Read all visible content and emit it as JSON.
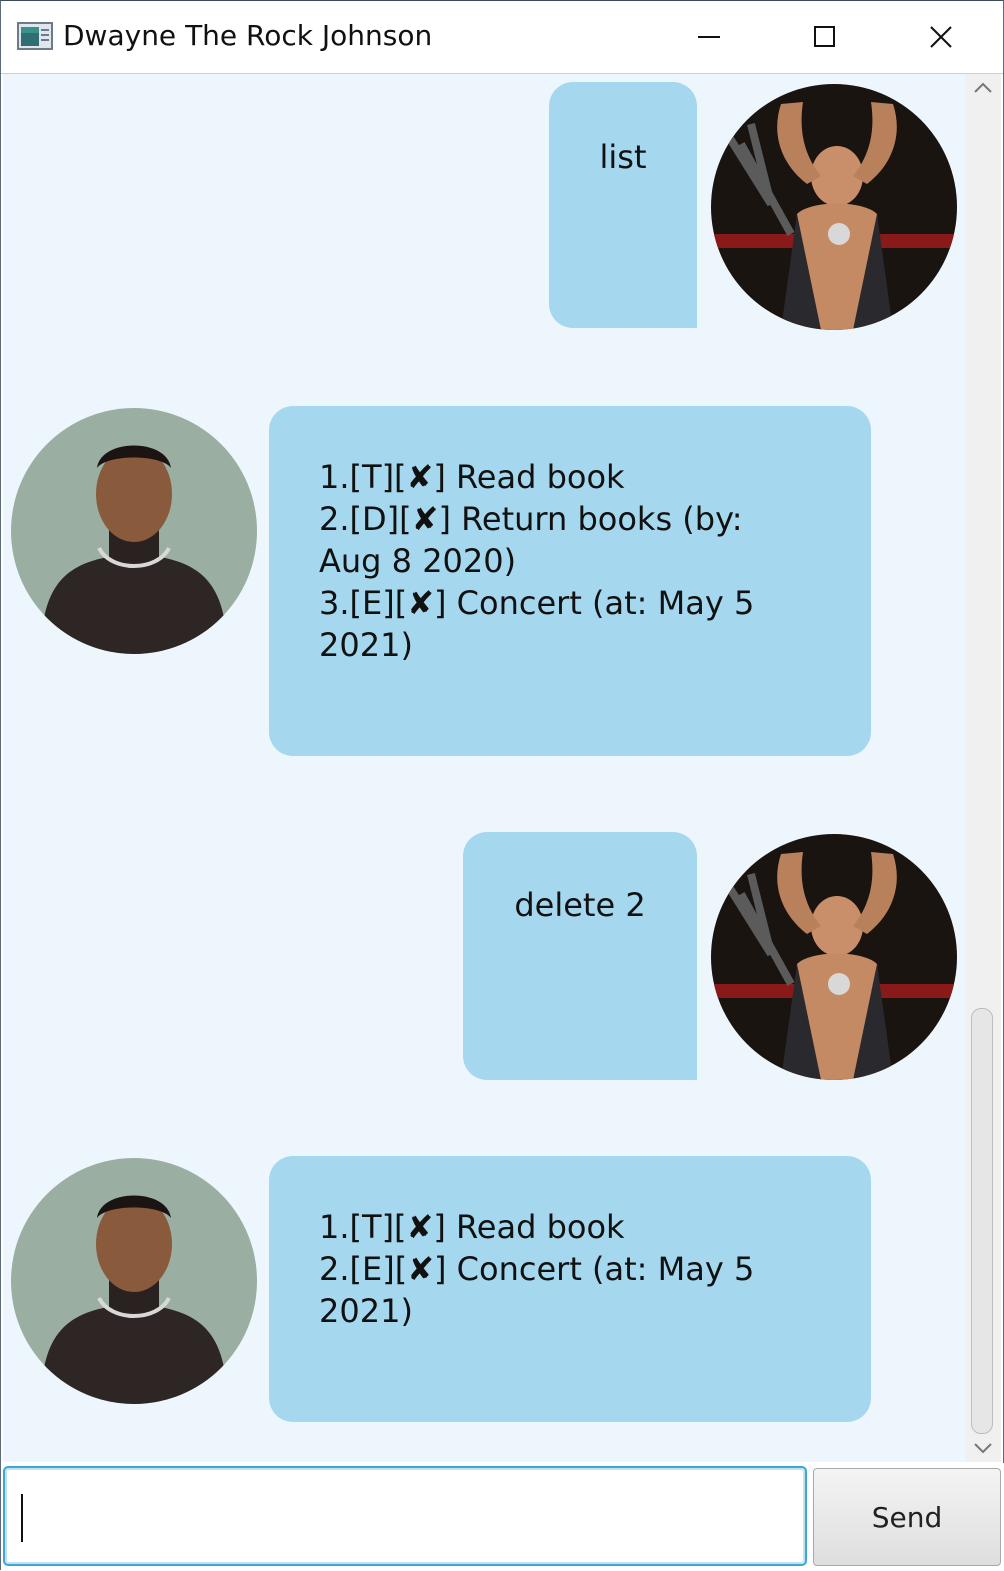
{
  "window": {
    "title": "Dwayne The Rock Johnson",
    "icons": {
      "app": "app-window-icon",
      "minimize": "minimize-icon",
      "maximize": "maximize-icon",
      "close": "close-icon"
    }
  },
  "messages": [
    {
      "sender": "user",
      "lines": [
        "list"
      ],
      "avatar": "user-avatar"
    },
    {
      "sender": "bot",
      "lines": [
        "1.[T][✘] Read book",
        "2.[D][✘] Return books (by:",
        "Aug 8 2020)",
        "3.[E][✘] Concert (at: May 5",
        "2021)"
      ],
      "avatar": "bot-avatar"
    },
    {
      "sender": "user",
      "lines": [
        "delete 2"
      ],
      "avatar": "user-avatar"
    },
    {
      "sender": "bot",
      "lines": [
        "1.[T][✘] Read book",
        "2.[E][✘] Concert (at: May 5",
        "2021)"
      ],
      "avatar": "bot-avatar"
    }
  ],
  "input": {
    "value": "",
    "placeholder": ""
  },
  "send_button": {
    "label": "Send"
  },
  "colors": {
    "chat_background": "#eef6fd",
    "bubble": "#a5d8ee",
    "input_focus": "#3fa6d6"
  }
}
